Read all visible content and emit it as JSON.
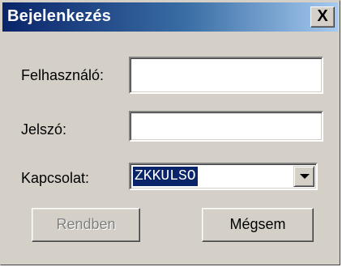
{
  "window": {
    "title": "Bejelenkezés",
    "close_label": "X"
  },
  "form": {
    "username_label": "Felhasználó:",
    "username_value": "",
    "password_label": "Jelszó:",
    "password_value": "",
    "connection_label": "Kapcsolat:",
    "connection_value": "ZKKULSO"
  },
  "buttons": {
    "ok_label": "Rendben",
    "ok_enabled": false,
    "cancel_label": "Mégsem"
  },
  "colors": {
    "titlebar_start": "#0a246a",
    "titlebar_end": "#a6caf0",
    "dialog_bg": "#d4d0c8",
    "selection": "#0a246a"
  },
  "icons": {
    "close": "close-icon",
    "dropdown": "chevron-down-icon"
  }
}
